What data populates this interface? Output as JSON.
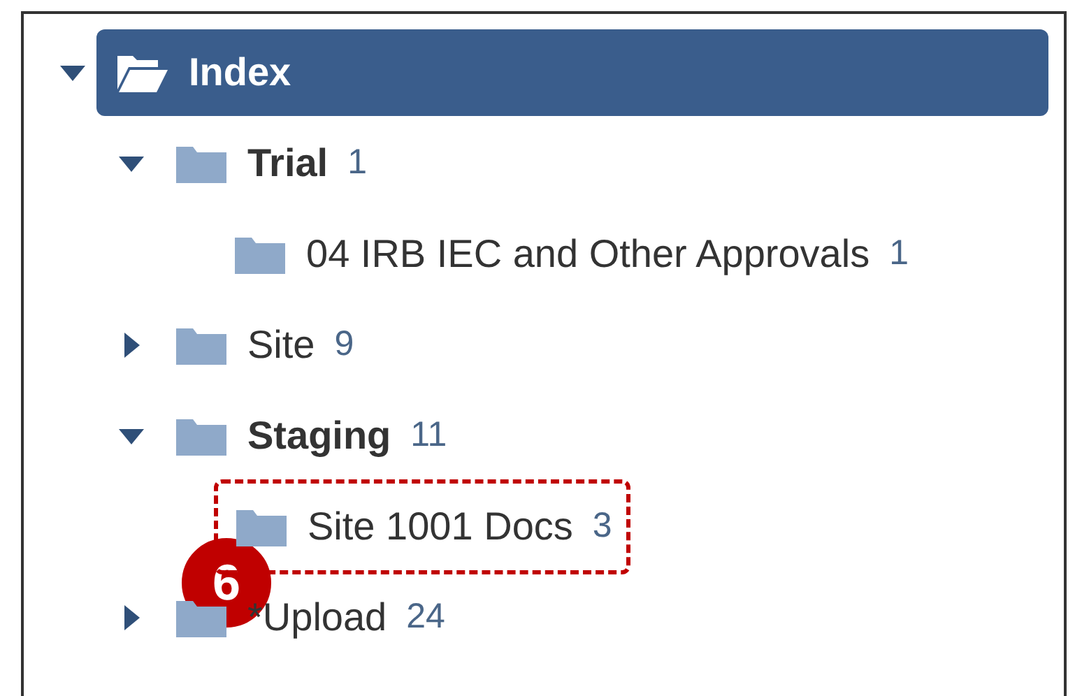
{
  "tree": [
    {
      "label": "Index",
      "expanded": true,
      "selected": true,
      "bold": true,
      "highlighted": false,
      "children": [
        {
          "label": "Trial",
          "count": "1",
          "expanded": true,
          "selected": false,
          "bold": true,
          "highlighted": false,
          "children": [
            {
              "label": "04 IRB IEC and Other Approvals",
              "count": "1",
              "selected": false,
              "bold": false,
              "highlighted": false
            }
          ]
        },
        {
          "label": "Site",
          "count": "9",
          "expanded": false,
          "selected": false,
          "bold": false,
          "highlighted": false
        },
        {
          "label": "Staging",
          "count": "11",
          "expanded": true,
          "selected": false,
          "bold": true,
          "highlighted": false,
          "children": [
            {
              "label": "Site 1001 Docs",
              "count": "3",
              "selected": false,
              "bold": false,
              "highlighted": true
            }
          ]
        },
        {
          "label": "*Upload",
          "count": "24",
          "expanded": false,
          "selected": false,
          "bold": false,
          "highlighted": false
        }
      ]
    }
  ],
  "callout": {
    "number": "6"
  }
}
